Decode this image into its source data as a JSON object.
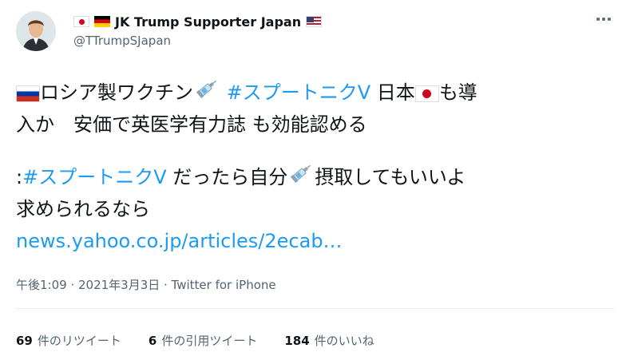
{
  "author": {
    "display_name": "JK Trump Supporter Japan",
    "handle": "@TTrumpSJapan",
    "name_flags_before": [
      "flag-jp",
      "flag-de"
    ],
    "name_flags_after": [
      "flag-us"
    ],
    "avatar": "avatar-icon"
  },
  "tweet": {
    "line1_a": "ロシア製ワクチン",
    "line1_hashtag": "#スプートニクV",
    "line1_b": " 日本",
    "line1_c": "も導",
    "line2": "入か　安価で英医学有力誌 も効能認める",
    "line3_prefix": ":",
    "line3_hashtag": "#スプートニクV",
    "line3_a": " だったら自分",
    "line3_b": "摂取してもいいよ",
    "line4": "求められるなら",
    "link": "news.yahoo.co.jp/articles/2ecab…"
  },
  "meta": {
    "timestamp": "午後1:09 · 2021年3月3日 · Twitter for iPhone"
  },
  "stats": {
    "retweets_count": "69",
    "retweets_label": "件のリツイート",
    "quotes_count": "6",
    "quotes_label": "件の引用ツイート",
    "likes_count": "184",
    "likes_label": "件のいいね"
  },
  "colors": {
    "link": "#1d9bf0",
    "text": "#0f1419",
    "secondary": "#536471",
    "divider": "#e6ecf0"
  }
}
